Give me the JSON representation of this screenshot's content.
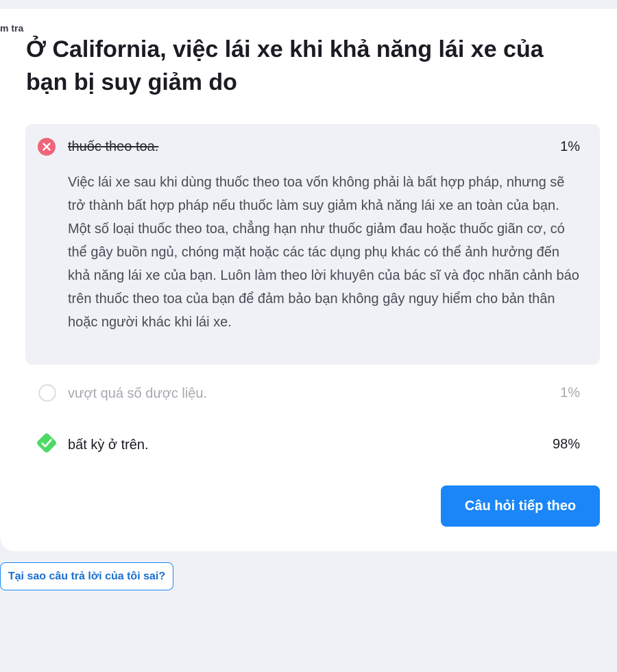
{
  "header": {
    "crumb": "m tra"
  },
  "question": {
    "text": "Ở California, việc lái xe khi khả năng lái xe của bạn bị suy giảm do"
  },
  "answers": [
    {
      "label": "thuốc theo toa.",
      "percent": "1%",
      "state": "wrong-selected",
      "icon": "x-circle-icon",
      "explanation": "Việc lái xe sau khi dùng thuốc theo toa vốn không phải là bất hợp pháp, nhưng sẽ trở thành bất hợp pháp nếu thuốc làm suy giảm khả năng lái xe an toàn của bạn. Một số loại thuốc theo toa, chẳng hạn như thuốc giảm đau hoặc thuốc giãn cơ, có thể gây buồn ngủ, chóng mặt hoặc các tác dụng phụ khác có thể ảnh hưởng đến khả năng lái xe của bạn. Luôn làm theo lời khuyên của bác sĩ và đọc nhãn cảnh báo trên thuốc theo toa của bạn để đảm bảo bạn không gây nguy hiểm cho bản thân hoặc người khác khi lái xe."
    },
    {
      "label": "vượt quá số dược liệu.",
      "percent": "1%",
      "state": "unselected",
      "icon": "empty-circle-icon"
    },
    {
      "label": "bất kỳ ở trên.",
      "percent": "98%",
      "state": "correct",
      "icon": "check-diamond-icon"
    }
  ],
  "buttons": {
    "next": "Câu hỏi tiếp theo",
    "why_wrong": "Tại sao câu trả lời của tôi sai?"
  },
  "colors": {
    "accent": "#1a86f8",
    "wrong": "#f0647a",
    "correct": "#4cd964",
    "panel": "#f0f1f6"
  }
}
